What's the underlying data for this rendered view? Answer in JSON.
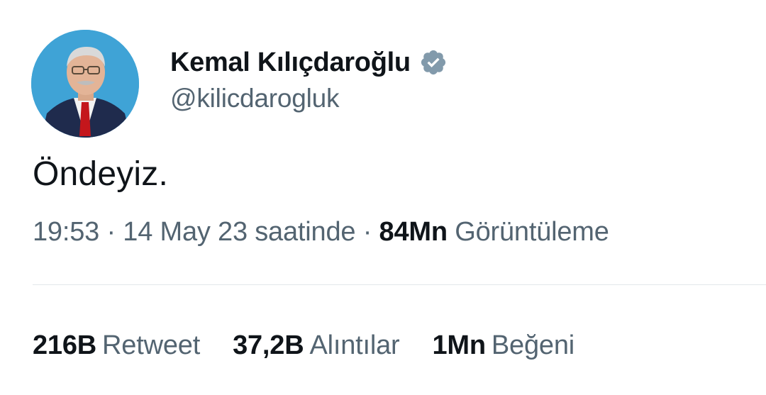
{
  "author": {
    "display_name": "Kemal Kılıçdaroğlu",
    "handle": "@kilicdarogluk",
    "verified_icon": "verified-badge-icon",
    "avatar_icon": "profile-photo"
  },
  "tweet": {
    "text": "Öndeyiz."
  },
  "meta": {
    "time": "19:53",
    "separator": " · ",
    "date": "14 May 23 saatinde",
    "views_count": "84Mn",
    "views_label": "Görüntüleme"
  },
  "stats": {
    "retweets_count": "216B",
    "retweets_label": "Retweet",
    "quotes_count": "37,2B",
    "quotes_label": "Alıntılar",
    "likes_count": "1Mn",
    "likes_label": "Beğeni"
  },
  "colors": {
    "text_primary": "#0f1419",
    "text_secondary": "#536471",
    "divider": "#e3e7ea",
    "verified_badge": "#829aab",
    "avatar_background": "#3fa3d6"
  }
}
